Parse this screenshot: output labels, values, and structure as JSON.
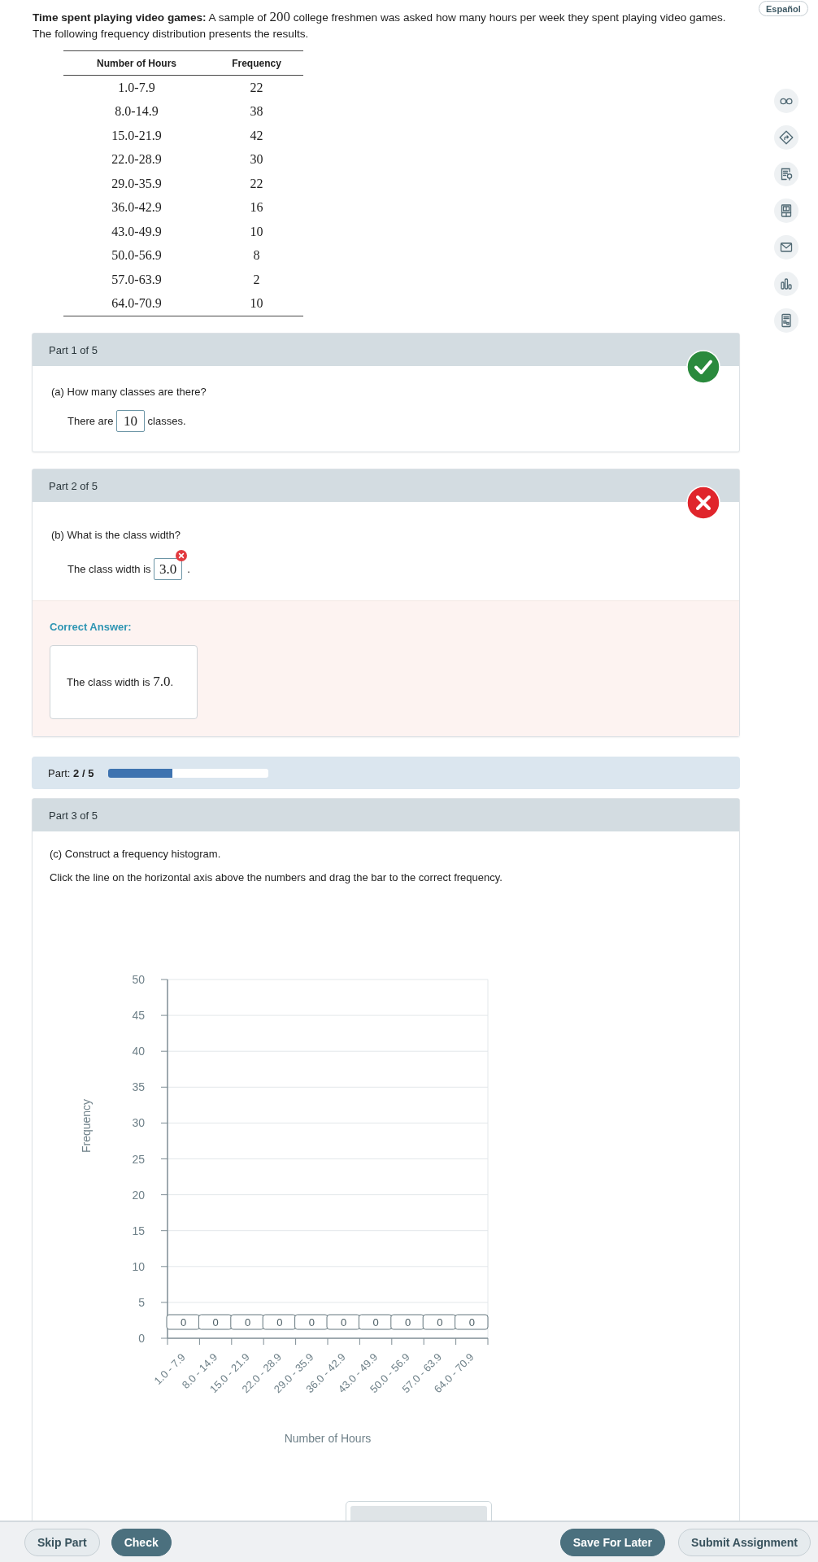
{
  "language_button": {
    "label": "Español"
  },
  "problem": {
    "segments": [
      {
        "kind": "text",
        "text": "**Time spent playing video games:** A sample of "
      },
      {
        "kind": "math",
        "text": "200"
      },
      {
        "kind": "text",
        "text": " college freshmen was asked how many hours per week they spent playing video games. The following frequency distribution presents the results."
      }
    ]
  },
  "table": {
    "columns": [
      "Number of Hours",
      "Frequency"
    ],
    "rows": [
      [
        "1.0-7.9",
        "22"
      ],
      [
        "8.0-14.9",
        "38"
      ],
      [
        "15.0-21.9",
        "42"
      ],
      [
        "22.0-28.9",
        "30"
      ],
      [
        "29.0-35.9",
        "22"
      ],
      [
        "36.0-42.9",
        "16"
      ],
      [
        "43.0-49.9",
        "10"
      ],
      [
        "50.0-56.9",
        "8"
      ],
      [
        "57.0-63.9",
        "2"
      ],
      [
        "64.0-70.9",
        "10"
      ]
    ]
  },
  "parts": [
    {
      "header": "Part 1 of 5",
      "correct": true,
      "question": "(a) How many classes are there?",
      "answer": [
        {
          "kind": "text",
          "text": "There are "
        },
        {
          "kind": "field",
          "value": "10",
          "marked_wrong": false
        },
        {
          "kind": "text",
          "text": " classes."
        }
      ]
    },
    {
      "header": "Part 2 of 5",
      "correct": false,
      "question": "(b) What is the class width?",
      "answer": [
        {
          "kind": "text",
          "text": "The class width is "
        },
        {
          "kind": "field",
          "value": "3.0",
          "marked_wrong": true
        },
        {
          "kind": "text",
          "text": "."
        }
      ],
      "correct_answer": {
        "label": "Correct Answer:",
        "segments": [
          {
            "kind": "text",
            "text": "The class width is "
          },
          {
            "kind": "math",
            "text": "7.0"
          },
          {
            "kind": "text",
            "text": "."
          }
        ]
      }
    }
  ],
  "progress": {
    "label": "Part: **2 / 5**",
    "level": 0.4
  },
  "current_part": {
    "header": "Part 3 of 5",
    "question": "(c) Construct a frequency histogram.",
    "instruction": "Click the line on the horizontal axis above the numbers and drag the bar to the correct frequency.",
    "chart_data": {
      "type": "bar",
      "xlabel": "Number of Hours",
      "ylabel": "Frequency",
      "categories": [
        "1.0 - 7.9",
        "8.0 - 14.9",
        "15.0 - 21.9",
        "22.0 - 28.9",
        "29.0 - 35.9",
        "36.0 - 42.9",
        "43.0 - 49.9",
        "50.0 - 56.9",
        "57.0 - 63.9",
        "64.0 - 70.9"
      ],
      "values": [
        0,
        0,
        0,
        0,
        0,
        0,
        0,
        0,
        0,
        0
      ],
      "ylim": [
        0,
        50
      ],
      "yticks": [
        0,
        5,
        10,
        15,
        20,
        25,
        30,
        35,
        40,
        45,
        50
      ],
      "grid": true,
      "data_labels": true
    }
  },
  "footer": {
    "left": [
      {
        "label": "Skip Part",
        "kind": "secondary"
      },
      {
        "label": "Check",
        "kind": "primary"
      }
    ],
    "right": [
      {
        "label": "Save For Later",
        "kind": "primary"
      },
      {
        "label": "Submit Assignment",
        "kind": "secondary"
      }
    ]
  }
}
